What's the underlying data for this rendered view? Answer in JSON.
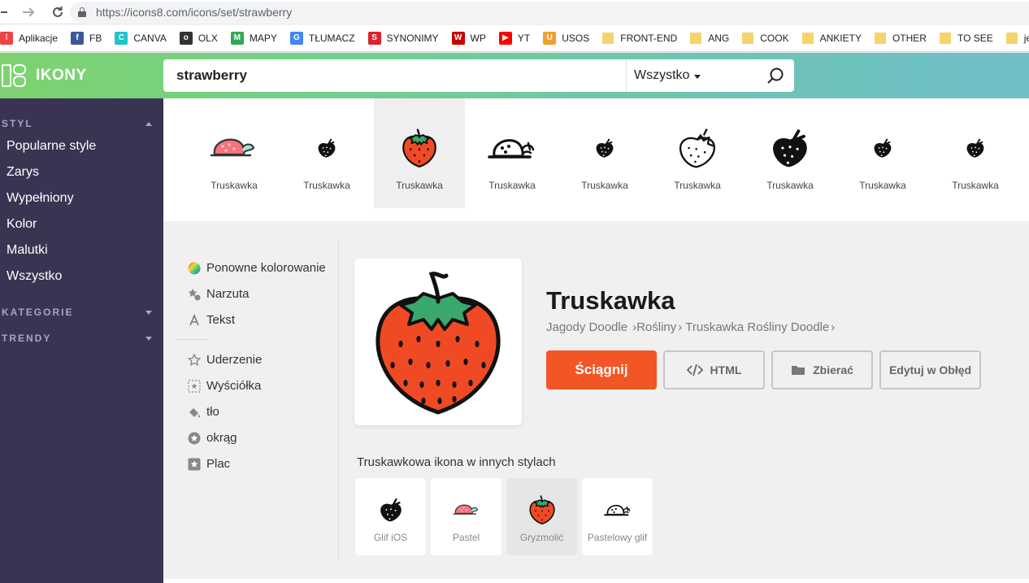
{
  "browser": {
    "url": "https://icons8.com/icons/set/strawberry",
    "back_icon": "arrow-left",
    "forward_icon": "arrow-right",
    "reload_icon": "reload"
  },
  "bookmarks": [
    {
      "label": "Aplikacje",
      "icon": "apps-grid",
      "color": "#e44"
    },
    {
      "label": "FB",
      "icon": "facebook",
      "color": "#3b5998"
    },
    {
      "label": "CANVA",
      "icon": "canva",
      "color": "#20c4cb"
    },
    {
      "label": "OLX",
      "icon": "olx",
      "color": "#333"
    },
    {
      "label": "MAPY",
      "icon": "maps",
      "color": "#34a853"
    },
    {
      "label": "TŁUMACZ",
      "icon": "translate",
      "color": "#4285f4"
    },
    {
      "label": "SYNONIMY",
      "icon": "letter-s",
      "color": "#d9232e"
    },
    {
      "label": "WP",
      "icon": "wp",
      "color": "#c00"
    },
    {
      "label": "YT",
      "icon": "youtube",
      "color": "#f00"
    },
    {
      "label": "USOS",
      "icon": "letter-u",
      "color": "#f0a030"
    },
    {
      "label": "FRONT-END",
      "icon": "folder",
      "color": "#f7d36b"
    },
    {
      "label": "ANG",
      "icon": "folder",
      "color": "#f7d36b"
    },
    {
      "label": "COOK",
      "icon": "folder",
      "color": "#f7d36b"
    },
    {
      "label": "ANKIETY",
      "icon": "folder",
      "color": "#f7d36b"
    },
    {
      "label": "OTHER",
      "icon": "folder",
      "color": "#f7d36b"
    },
    {
      "label": "TO SEE",
      "icon": "folder",
      "color": "#f7d36b"
    },
    {
      "label": "jednow",
      "icon": "folder",
      "color": "#f7d36b"
    }
  ],
  "header": {
    "logo_text": "IKONY",
    "search_value": "strawberry",
    "filter_value": "Wszystko",
    "search_icon": "search-icon"
  },
  "sidebar": {
    "styl_label": "STYL",
    "items": [
      "Popularne style",
      "Zarys",
      "Wypełniony",
      "Kolor",
      "Malutki",
      "Wszystko"
    ],
    "kategorie_label": "KATEGORIE",
    "trendy_label": "TRENDY"
  },
  "strip": [
    {
      "label": "Truskawka",
      "style": "pastel"
    },
    {
      "label": "Truskawka",
      "style": "glyph-small"
    },
    {
      "label": "Truskawka",
      "style": "doodle",
      "selected": true
    },
    {
      "label": "Truskawka",
      "style": "pastel-glyph"
    },
    {
      "label": "Truskawka",
      "style": "glyph-small"
    },
    {
      "label": "Truskawka",
      "style": "outline"
    },
    {
      "label": "Truskawka",
      "style": "glyph-large"
    },
    {
      "label": "Truskawka",
      "style": "glyph-small"
    },
    {
      "label": "Truskawka",
      "style": "glyph-small"
    }
  ],
  "tools": [
    {
      "label": "Ponowne kolorowanie",
      "icon": "color-wheel-icon"
    },
    {
      "label": "Narzuta",
      "icon": "overlay-icon"
    },
    {
      "label": "Tekst",
      "icon": "text-icon"
    },
    {
      "label": "Uderzenie",
      "icon": "stroke-star-icon"
    },
    {
      "label": "Wyściółka",
      "icon": "padding-icon"
    },
    {
      "label": "tło",
      "icon": "paint-bucket-icon"
    },
    {
      "label": "okrąg",
      "icon": "circle-star-icon"
    },
    {
      "label": "Plac",
      "icon": "square-star-icon"
    }
  ],
  "detail": {
    "title": "Truskawka",
    "breadcrumbs": [
      "Jagody Doodle",
      "Rośliny",
      "Truskawka Rośliny Doodle"
    ],
    "download_label": "Ściągnij",
    "html_label": "HTML",
    "collect_label": "Zbierać",
    "edit_label": "Edytuj w Obłęd"
  },
  "other_styles": {
    "title": "Truskawkowa ikona w innych stylach",
    "items": [
      {
        "label": "Glif iOS",
        "style": "glyph-large"
      },
      {
        "label": "Pastel",
        "style": "pastel"
      },
      {
        "label": "Gryzmolić",
        "style": "doodle",
        "selected": true
      },
      {
        "label": "Pastelowy glif",
        "style": "pastel-glyph"
      }
    ]
  },
  "colors": {
    "download": "#f25625",
    "sidebar": "#3a3452",
    "strawberry_red": "#f04a24",
    "leaf_green": "#3aa76d"
  }
}
